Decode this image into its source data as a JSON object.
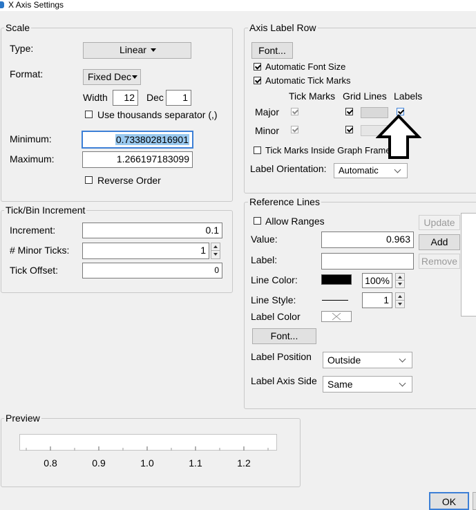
{
  "window": {
    "title": "X Axis Settings"
  },
  "scale": {
    "legend": "Scale",
    "type_label": "Type:",
    "type_value": "Linear",
    "format_label": "Format:",
    "format_value": "Fixed Dec",
    "width_label": "Width",
    "width_value": "12",
    "dec_label": "Dec",
    "dec_value": "1",
    "thousands_label": "Use thousands separator (,)",
    "thousands_checked": false,
    "minimum_label": "Minimum:",
    "minimum_value": "0.733802816901",
    "maximum_label": "Maximum:",
    "maximum_value": "1.266197183099",
    "reverse_label": "Reverse Order",
    "reverse_checked": false
  },
  "tick": {
    "legend": "Tick/Bin Increment",
    "increment_label": "Increment:",
    "increment_value": "0.1",
    "minor_label": "# Minor Ticks:",
    "minor_value": "1",
    "offset_label": "Tick Offset:",
    "offset_value": "0"
  },
  "axis_label_row": {
    "legend": "Axis Label Row",
    "font_button": "Font...",
    "auto_font_label": "Automatic Font Size",
    "auto_font_checked": true,
    "auto_tick_label": "Automatic Tick Marks",
    "auto_tick_checked": true,
    "col_tick": "Tick Marks",
    "col_grid": "Grid Lines",
    "col_labels": "Labels",
    "major_label": "Major",
    "minor_label": "Minor",
    "inside_label": "Tick Marks Inside Graph Frame",
    "orientation_label": "Label Orientation:",
    "orientation_value": "Automatic"
  },
  "reference_lines": {
    "legend": "Reference Lines",
    "allow_ranges_label": "Allow Ranges",
    "value_label": "Value:",
    "value": "0.963",
    "label_label": "Label:",
    "label_value": "",
    "line_color_label": "Line Color:",
    "line_color": "#000000",
    "opacity_value": "100%",
    "line_style_label": "Line Style:",
    "line_width_value": "1",
    "label_color_label": "Label Color",
    "font_button": "Font...",
    "label_position_label": "Label Position",
    "label_position_value": "Outside",
    "label_axis_side_label": "Label Axis Side",
    "label_axis_side_value": "Same",
    "update_button": "Update",
    "add_button": "Add",
    "remove_button": "Remove"
  },
  "preview": {
    "legend": "Preview",
    "tick_labels": [
      "0.8",
      "0.9",
      "1.0",
      "1.1",
      "1.2"
    ]
  },
  "footer": {
    "ok_button": "OK"
  }
}
